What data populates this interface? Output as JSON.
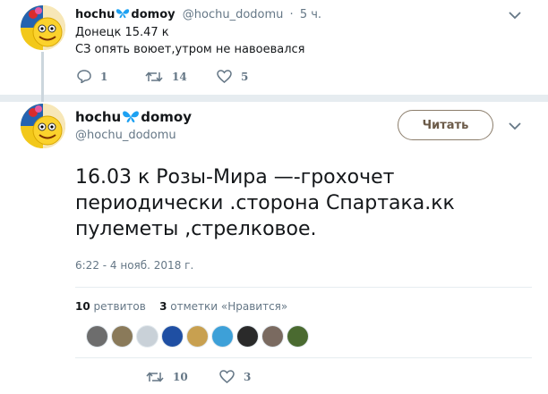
{
  "parent_tweet": {
    "display_name_part1": "hochu",
    "display_name_part2": "domoy",
    "handle": "@hochu_dodomu",
    "dot": "·",
    "time": "5 ч.",
    "text_line1": "Донецк 15.47 к",
    "text_line2": " СЗ опять воюет,утром не навоевался",
    "replies": "1",
    "retweets": "14",
    "likes": "5"
  },
  "main_tweet": {
    "display_name_part1": "hochu",
    "display_name_part2": "domoy",
    "handle": "@hochu_dodomu",
    "follow_label": "Читать",
    "text": "16.03 к Розы-Мира —-грохочет периодически .сторона Спартака.кк пулеметы ,стрелковое.",
    "date": "6:22 - 4 нояб. 2018 г.",
    "retweet_count": "10",
    "retweet_label": "ретвитов",
    "like_count": "3",
    "like_label": "отметки «Нравится»",
    "action_retweets": "10",
    "action_likes": "3"
  },
  "liker_colors": [
    "#6d6d6d",
    "#8a7a5a",
    "#c9d1d8",
    "#1f4fa3",
    "#c8a050",
    "#3da0d8",
    "#2a2a2a",
    "#7a6a60",
    "#4a6a30"
  ],
  "colors": {
    "accent_border": "#8b7d6b",
    "separator": "#e6ecf0",
    "muted": "#657786",
    "butterfly": "#1da1f2"
  }
}
